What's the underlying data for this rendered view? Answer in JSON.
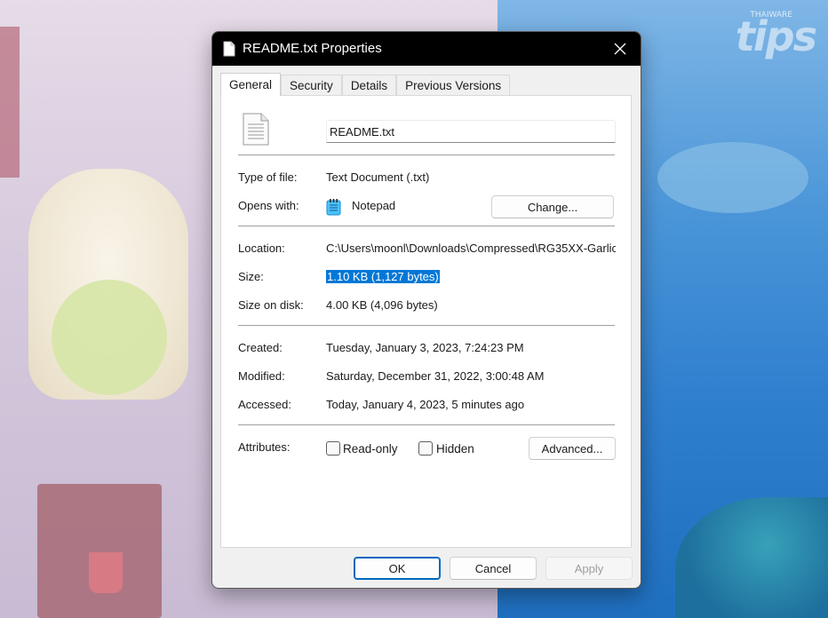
{
  "window": {
    "title": "README.txt Properties",
    "close_symbol": "✕"
  },
  "watermark": {
    "brand": "tips",
    "sub": "THAIWARE"
  },
  "tabs": [
    {
      "label": "General",
      "active": true
    },
    {
      "label": "Security",
      "active": false
    },
    {
      "label": "Details",
      "active": false
    },
    {
      "label": "Previous Versions",
      "active": false
    }
  ],
  "general": {
    "file_name": "README.txt",
    "type_label": "Type of file:",
    "type_value": "Text Document (.txt)",
    "opens_label": "Opens with:",
    "opens_value": "Notepad",
    "change_button": "Change...",
    "location_label": "Location:",
    "location_value": "C:\\Users\\moonl\\Downloads\\Compressed\\RG35XX-Garlic",
    "size_label": "Size:",
    "size_value": "1.10 KB (1,127 bytes)",
    "size_on_disk_label": "Size on disk:",
    "size_on_disk_value": "4.00 KB (4,096 bytes)",
    "created_label": "Created:",
    "created_value": "Tuesday, January 3, 2023, 7:24:23 PM",
    "modified_label": "Modified:",
    "modified_value": "Saturday, December 31, 2022, 3:00:48 AM",
    "accessed_label": "Accessed:",
    "accessed_value": "Today, January 4, 2023, 5 minutes ago",
    "attributes_label": "Attributes:",
    "readonly_label": "Read-only",
    "readonly_checked": false,
    "hidden_label": "Hidden",
    "hidden_checked": false,
    "advanced_button": "Advanced..."
  },
  "footer": {
    "ok": "OK",
    "cancel": "Cancel",
    "apply": "Apply"
  },
  "colors": {
    "selection": "#0078d7",
    "titlebar": "#000000",
    "primary_border": "#0067c0"
  }
}
